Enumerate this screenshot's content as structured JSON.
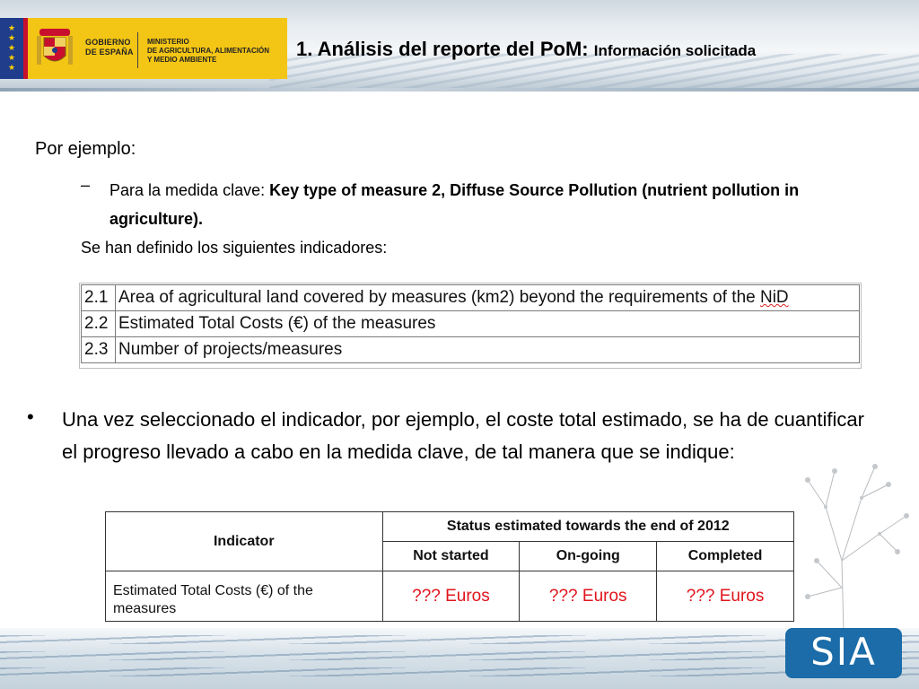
{
  "header": {
    "gov_line1": "GOBIERNO",
    "gov_line2": "DE ESPAÑA",
    "ministry_line1": "MINISTERIO",
    "ministry_line2": "DE AGRICULTURA, ALIMENTACIÓN",
    "ministry_line3": "Y MEDIO AMBIENTE",
    "title_main": "1. Análisis del reporte del PoM:",
    "title_sub": "Información solicitada"
  },
  "content": {
    "por_ejemplo": "Por ejemplo:",
    "dash": "–",
    "medida_prefix": "Para la medida clave: ",
    "medida_bold": "Key type of measure 2, Diffuse Source Pollution (nutrient pollution in agriculture).",
    "se_han": "Se han definido los siguientes indicadores:",
    "indicators": [
      {
        "num": "2.1",
        "text": "Area of agricultural land covered by measures (km2) beyond the requirements of the ",
        "tail": "NiD"
      },
      {
        "num": "2.2",
        "text": "Estimated Total Costs (€) of the measures"
      },
      {
        "num": "2.3",
        "text": "Number of projects/measures"
      }
    ],
    "bullet": "•",
    "una_vez": "Una vez seleccionado el indicador, por ejemplo, el coste total estimado, se ha de cuantificar el progreso llevado a cabo en la medida clave, de tal manera que se indique:"
  },
  "status_table": {
    "indicator_header": "Indicator",
    "status_header": "Status estimated towards the end of 2012",
    "col_not_started": "Not started",
    "col_on_going": "On-going",
    "col_completed": "Completed",
    "row_label": "Estimated Total Costs (€) of the measures",
    "val_not_started": "??? Euros",
    "val_on_going": "??? Euros",
    "val_completed": "??? Euros"
  },
  "footer": {
    "logo_text": "SIA"
  },
  "colors": {
    "accent_red": "#e0141c",
    "gov_yellow": "#f3c515",
    "logo_blue": "#1b6ca8"
  }
}
